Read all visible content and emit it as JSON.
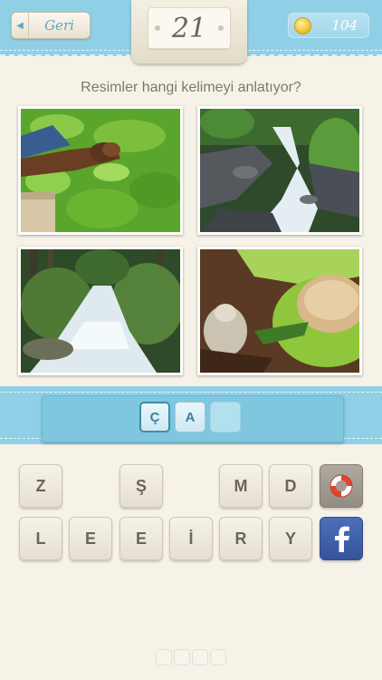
{
  "header": {
    "back_label": "Geri",
    "level": "21",
    "coins": "104"
  },
  "question": "Resimler hangi kelimeyi anlatıyor?",
  "photos": [
    {
      "subject": "tea-picking"
    },
    {
      "subject": "rocky-stream"
    },
    {
      "subject": "forest-river"
    },
    {
      "subject": "cup-of-tea"
    }
  ],
  "answer": {
    "letters": [
      "Ç",
      "A",
      ""
    ]
  },
  "keyboard": {
    "row1": [
      "Z",
      "",
      "Ş",
      "",
      "M",
      "D"
    ],
    "row2": [
      "L",
      "E",
      "E",
      "İ",
      "R",
      "Y"
    ],
    "help_icon": "lifebuoy-icon",
    "share_icon": "facebook-icon"
  },
  "colors": {
    "accent": "#8fd0e6",
    "background": "#f7f2e8",
    "facebook": "#3b5998"
  }
}
